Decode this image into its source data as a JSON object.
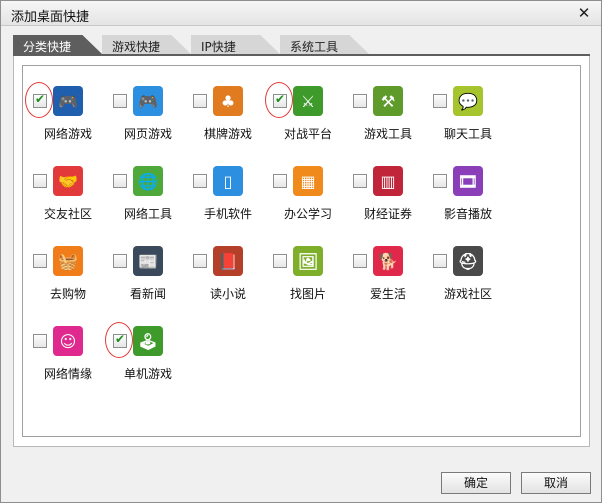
{
  "dialog": {
    "title": "添加桌面快捷",
    "close_glyph": "✕"
  },
  "tabs": [
    {
      "label": "分类快捷",
      "active": true
    },
    {
      "label": "游戏快捷",
      "active": false
    },
    {
      "label": "IP快捷",
      "active": false
    },
    {
      "label": "系统工具",
      "active": false
    }
  ],
  "items": [
    {
      "label": "网络游戏",
      "checked": true,
      "icon": "gamepad-icon",
      "glyph": "🎮",
      "color": "#1f5fae",
      "highlighted": true
    },
    {
      "label": "网页游戏",
      "checked": false,
      "icon": "web-gamepad-icon",
      "glyph": "🎮",
      "color": "#2d8fe0",
      "highlighted": false
    },
    {
      "label": "棋牌游戏",
      "checked": false,
      "icon": "cards-icon",
      "glyph": "♣",
      "color": "#e07b1f",
      "highlighted": false
    },
    {
      "label": "对战平台",
      "checked": true,
      "icon": "crossed-swords-icon",
      "glyph": "⚔",
      "color": "#3f9a2c",
      "highlighted": true
    },
    {
      "label": "游戏工具",
      "checked": false,
      "icon": "tools-icon",
      "glyph": "⚒",
      "color": "#5e9b2a",
      "highlighted": false
    },
    {
      "label": "聊天工具",
      "checked": false,
      "icon": "chat-bubble-icon",
      "glyph": "💬",
      "color": "#a6c42d",
      "highlighted": false
    },
    {
      "label": "交友社区",
      "checked": false,
      "icon": "handshake-icon",
      "glyph": "🤝",
      "color": "#e23a3a",
      "highlighted": false
    },
    {
      "label": "网络工具",
      "checked": false,
      "icon": "globe-icon",
      "glyph": "🌐",
      "color": "#4fa83a",
      "highlighted": false
    },
    {
      "label": "手机软件",
      "checked": false,
      "icon": "phone-icon",
      "glyph": "▯",
      "color": "#2d8fe0",
      "highlighted": false
    },
    {
      "label": "办公学习",
      "checked": false,
      "icon": "grid-apps-icon",
      "glyph": "▦",
      "color": "#f08a1c",
      "highlighted": false
    },
    {
      "label": "财经证券",
      "checked": false,
      "icon": "bar-chart-icon",
      "glyph": "▥",
      "color": "#c0253a",
      "highlighted": false
    },
    {
      "label": "影音播放",
      "checked": false,
      "icon": "film-reel-icon",
      "glyph": "🎞",
      "color": "#8a3fb8",
      "highlighted": false
    },
    {
      "label": "去购物",
      "checked": false,
      "icon": "basket-icon",
      "glyph": "🧺",
      "color": "#f07d1a",
      "highlighted": false
    },
    {
      "label": "看新闻",
      "checked": false,
      "icon": "newspaper-icon",
      "glyph": "📰",
      "color": "#3a4a5c",
      "highlighted": false
    },
    {
      "label": "读小说",
      "checked": false,
      "icon": "book-icon",
      "glyph": "📕",
      "color": "#b5402a",
      "highlighted": false
    },
    {
      "label": "找图片",
      "checked": false,
      "icon": "picture-icon",
      "glyph": "🖼",
      "color": "#7fae2a",
      "highlighted": false
    },
    {
      "label": "爱生活",
      "checked": false,
      "icon": "dog-icon",
      "glyph": "🐕",
      "color": "#e0294a",
      "highlighted": false
    },
    {
      "label": "游戏社区",
      "checked": false,
      "icon": "spartan-helmet-icon",
      "glyph": "⛑",
      "color": "#4a4a4a",
      "highlighted": false
    },
    {
      "label": "网络情缘",
      "checked": false,
      "icon": "heart-face-icon",
      "glyph": "☺",
      "color": "#e0298e",
      "highlighted": false
    },
    {
      "label": "单机游戏",
      "checked": true,
      "icon": "joystick-icon",
      "glyph": "🕹",
      "color": "#3f9a2c",
      "highlighted": true
    }
  ],
  "buttons": {
    "ok": "确定",
    "cancel": "取消"
  }
}
